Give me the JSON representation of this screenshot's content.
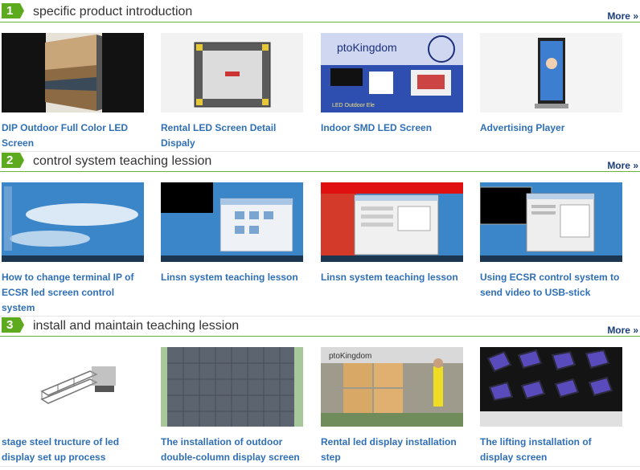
{
  "sections": [
    {
      "number": "1",
      "title": "specific product introduction",
      "more_label": "More »",
      "items": [
        {
          "caption": "DIP Outdoor Full Color LED Screen"
        },
        {
          "caption": "Rental LED Screen Detail Dispaly"
        },
        {
          "caption": "Indoor SMD LED Screen",
          "thumb_text": "ptoKingdom",
          "thumb_text2": "LED Outdoor Ele"
        },
        {
          "caption": "Advertising Player"
        }
      ]
    },
    {
      "number": "2",
      "title": "control system teaching lession",
      "more_label": "More »",
      "items": [
        {
          "caption": "How to change terminal IP of ECSR led screen control system"
        },
        {
          "caption": "Linsn system teaching lesson"
        },
        {
          "caption": "Linsn system teaching lesson"
        },
        {
          "caption": "Using ECSR control system to send video to USB-stick"
        }
      ]
    },
    {
      "number": "3",
      "title": "install and maintain teaching lession",
      "more_label": "More »",
      "items": [
        {
          "caption": "stage steel tructure of led display set up process"
        },
        {
          "caption": "The installation of outdoor double-column display screen"
        },
        {
          "caption": "Rental led display installation step",
          "thumb_text": "ptoKingdom"
        },
        {
          "caption": "The lifting installation of display screen"
        }
      ]
    }
  ]
}
